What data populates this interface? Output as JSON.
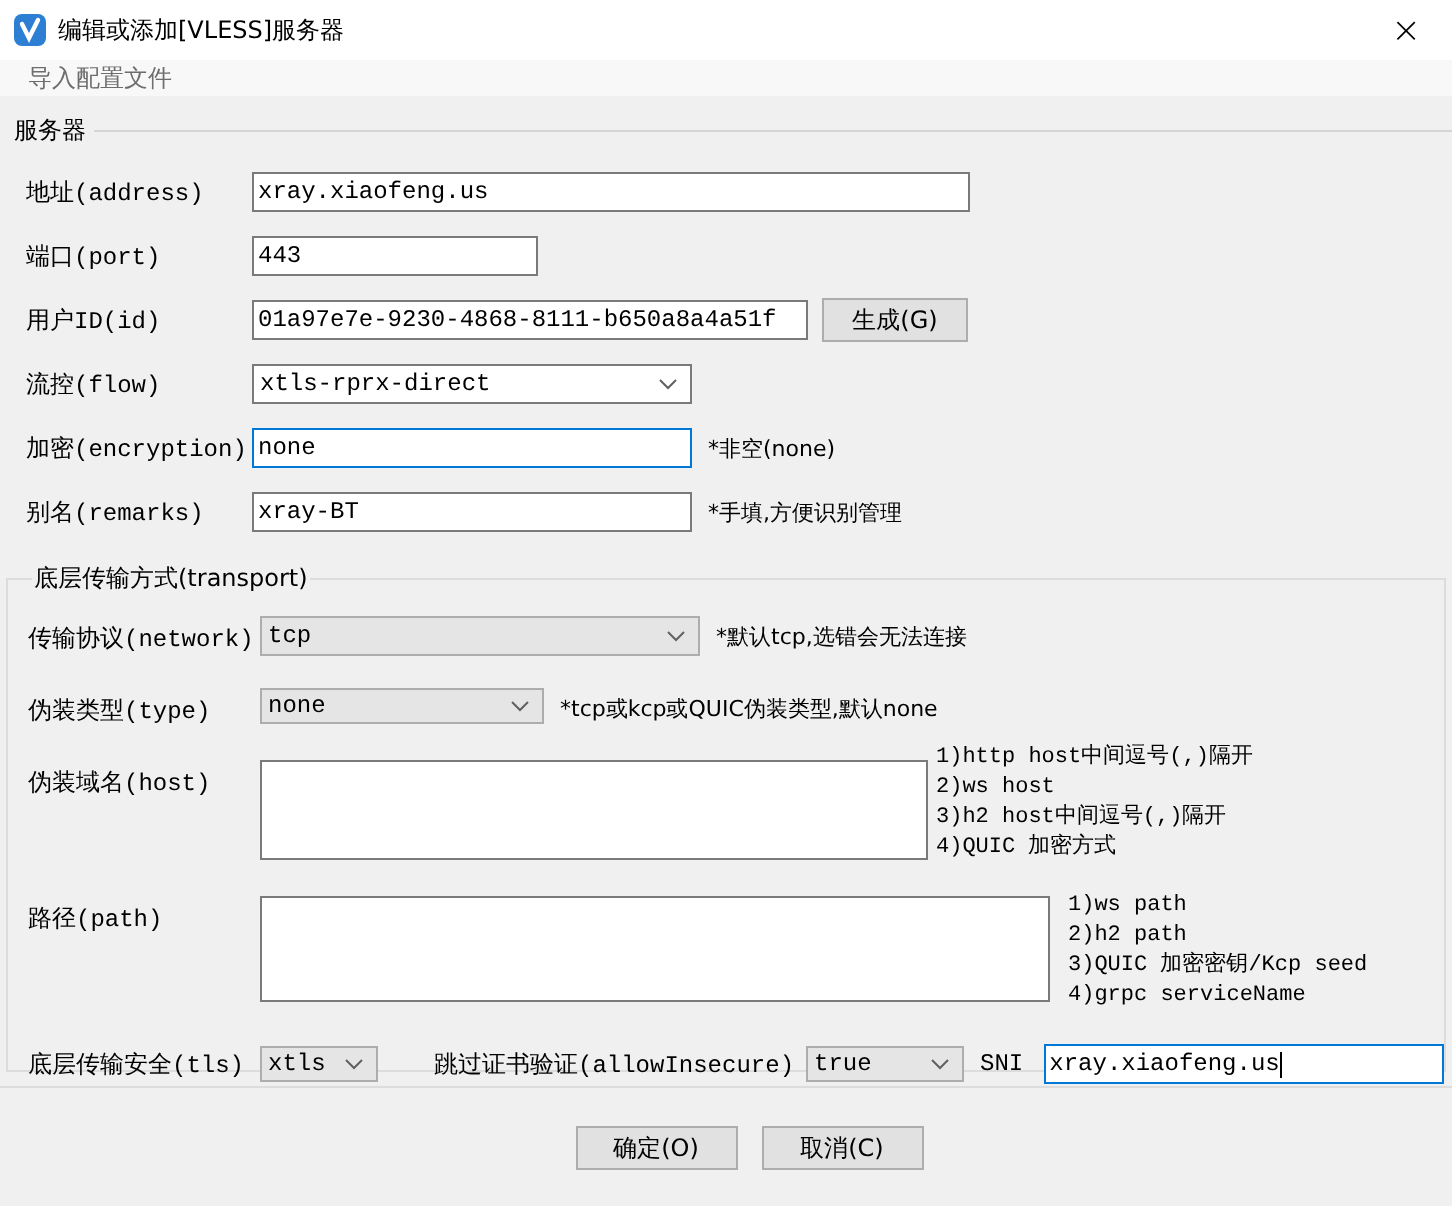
{
  "window": {
    "title": "编辑或添加[VLESS]服务器",
    "close": "×"
  },
  "menu": [
    {
      "label": "导入配置文件"
    }
  ],
  "server": {
    "title": "服务器",
    "fields": [
      {
        "kind": "text",
        "label": "地址(address)",
        "value": "xray.xiaofeng.us",
        "focused": false
      },
      {
        "kind": "text",
        "label": "端口(port)",
        "value": "443",
        "focused": false
      },
      {
        "kind": "text",
        "label": "用户ID(id)",
        "value": "01a97e7e-9230-4868-8111-b650a8a4a51f",
        "focused": false,
        "button": "生成(G)"
      },
      {
        "kind": "combo",
        "label": "流控(flow)",
        "value": "xtls-rprx-direct"
      },
      {
        "kind": "text",
        "label": "加密(encryption)",
        "value": "none",
        "focused": true,
        "hint": "*非空(none)"
      },
      {
        "kind": "text",
        "label": "别名(remarks)",
        "value": "xray-BT",
        "focused": false,
        "hint": "*手填,方便识别管理"
      }
    ]
  },
  "transport": {
    "title": "底层传输方式(transport)",
    "fields": [
      {
        "kind": "select",
        "label": "传输协议(network)",
        "value": "tcp",
        "hint": "*默认tcp,选错会无法连接"
      },
      {
        "kind": "select",
        "label": "伪装类型(type)",
        "value": "none",
        "hint": "*tcp或kcp或QUIC伪装类型,默认none"
      },
      {
        "kind": "textarea",
        "label": "伪装域名(host)",
        "hints": [
          "1)http host中间逗号(,)隔开",
          "2)ws host",
          "3)h2 host中间逗号(,)隔开",
          "4)QUIC 加密方式"
        ]
      },
      {
        "kind": "textarea",
        "label": "路径(path)",
        "hints": [
          "1)ws path",
          "2)h2 path",
          "3)QUIC 加密密钥/Kcp seed",
          "4)grpc serviceName"
        ]
      }
    ],
    "security": {
      "label": "底层传输安全(tls)",
      "value": "xtls",
      "allow_insecure": {
        "label": "跳过证书验证(allowInsecure)",
        "value": "true"
      },
      "sni": {
        "label": "SNI",
        "value": "xray.xiaofeng.us",
        "focused": true
      }
    }
  },
  "buttons": [
    {
      "label": "确定(O)"
    },
    {
      "label": "取消(C)"
    }
  ]
}
